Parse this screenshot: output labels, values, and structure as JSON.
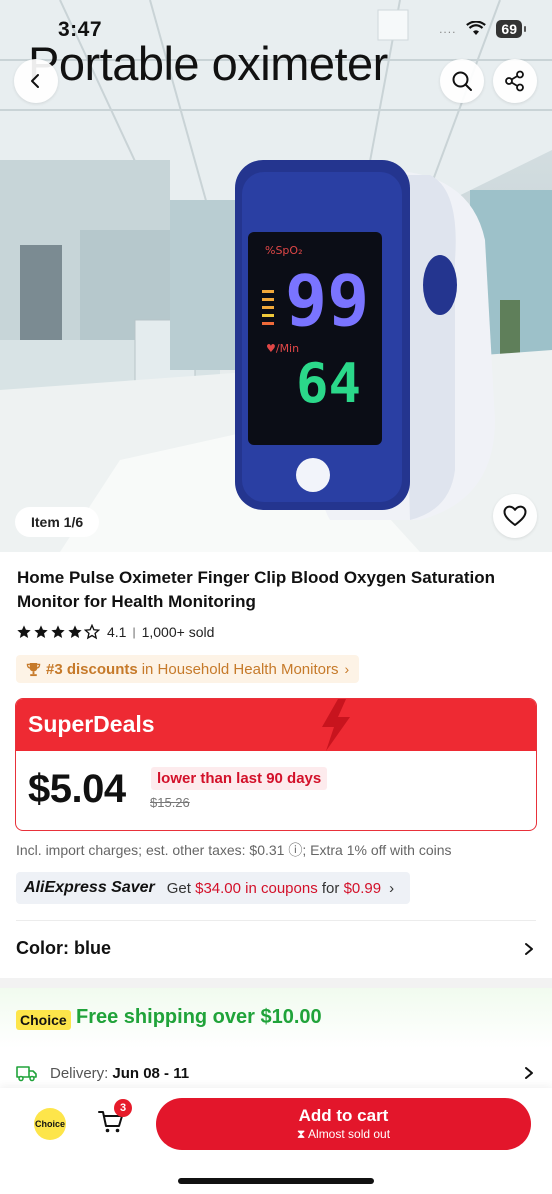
{
  "status_bar": {
    "time": "3:47",
    "signal": "....",
    "battery": "69"
  },
  "hero": {
    "title": "Portable oximeter",
    "device_spo2_label": "%SpO₂",
    "device_spo2_value": "99",
    "device_pulse_label": "♥/Min",
    "device_pulse_value": "64",
    "item_counter": "Item 1/6"
  },
  "icons": {
    "back": "chevron-left-icon",
    "search": "search-icon",
    "share": "share-icon",
    "favorite": "heart-icon"
  },
  "product": {
    "title": "Home Pulse Oximeter Finger Clip Blood Oxygen Saturation Monitor for Health Monitoring",
    "rating": "4.1",
    "rating_stars": 4.1,
    "sold": "1,000+ sold",
    "rank_highlight": "#3 discounts",
    "rank_suffix": "in Household Health Monitors"
  },
  "deal": {
    "label": "SuperDeals",
    "price": "$5.04",
    "lower_note": "lower than last 90 days",
    "old_price": "$15.26"
  },
  "tax_line": "Incl. import charges; est. other taxes: $0.31 ⓘ; Extra 1% off with coins",
  "saver": {
    "brand": "AliExpress Saver",
    "get": "Get",
    "coupon": "$34.00 in coupons",
    "for": "for",
    "cost": "$0.99"
  },
  "color": {
    "label": "Color: blue"
  },
  "shipping": {
    "badge": "Choice",
    "text": "Free shipping over $10.00"
  },
  "delivery": {
    "label": "Delivery:",
    "dates": "Jun 08 - 11"
  },
  "bottom_bar": {
    "choice_label": "Choice",
    "cart_count": "3",
    "add_to_cart": "Add to cart",
    "stock_note": "⧗ Almost sold out"
  },
  "colors": {
    "accent_red": "#e3162b",
    "superdeals_red": "#ee2a33",
    "ship_green": "#20a33a",
    "rank_orange": "#c67a2a",
    "choice_yellow": "#fde54a",
    "device_blue": "#24358f"
  }
}
